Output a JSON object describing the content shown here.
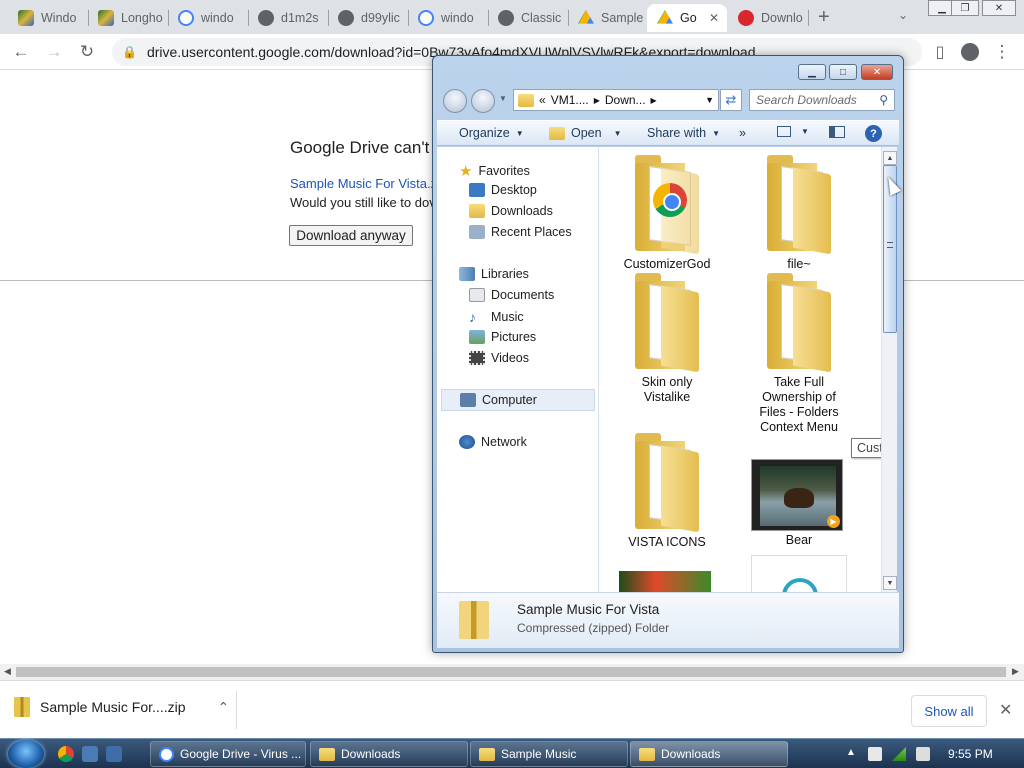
{
  "tabs": [
    {
      "label": "Windo",
      "icon": "image-icon"
    },
    {
      "label": "Longho",
      "icon": "image-icon"
    },
    {
      "label": "windo",
      "icon": "google-icon"
    },
    {
      "label": "d1m2s",
      "icon": "globe-icon"
    },
    {
      "label": "d99ylic",
      "icon": "globe-icon"
    },
    {
      "label": "windo",
      "icon": "google-icon"
    },
    {
      "label": "Classic",
      "icon": "globe-icon"
    },
    {
      "label": "Sample",
      "icon": "drive-icon"
    },
    {
      "label": "Go",
      "icon": "drive-icon",
      "active": true
    },
    {
      "label": "Downlo",
      "icon": "mega-icon"
    }
  ],
  "toolbar": {
    "url": "drive.usercontent.google.com/download?id=0Bw73yAfo4mdXVUWplVSVlwRFk&export=download"
  },
  "page": {
    "error_title": "Google Drive can't s",
    "file_link": "Sample Music For Vista.z",
    "question": "Would you still like to dov",
    "download_anyway": "Download anyway"
  },
  "explorer": {
    "address_prefix": "«",
    "crumbs": [
      "VM1....",
      "Down..."
    ],
    "search_placeholder": "Search Downloads",
    "commands": {
      "organize": "Organize",
      "open": "Open",
      "share_with": "Share with",
      "more": "»"
    },
    "nav": {
      "favorites": "Favorites",
      "desktop": "Desktop",
      "downloads": "Downloads",
      "recent": "Recent Places",
      "libraries": "Libraries",
      "documents": "Documents",
      "music": "Music",
      "pictures": "Pictures",
      "videos": "Videos",
      "computer": "Computer",
      "network": "Network"
    },
    "items": [
      "CustomizerGod",
      "file~",
      "Skin only Vistalike",
      "Take Full Ownership of Files - Folders Context Menu",
      "VISTA ICONS",
      "Bear"
    ],
    "tooltip": "CustomizerGod",
    "details": {
      "name": "Sample Music For Vista",
      "kind": "Compressed (zipped) Folder"
    }
  },
  "downloads_bar": {
    "item": "Sample Music For....zip",
    "show_all": "Show all"
  },
  "taskbar": {
    "buttons": [
      "Google Drive - Virus ...",
      "Downloads",
      "Sample Music",
      "Downloads"
    ],
    "clock": "9:55 PM"
  }
}
